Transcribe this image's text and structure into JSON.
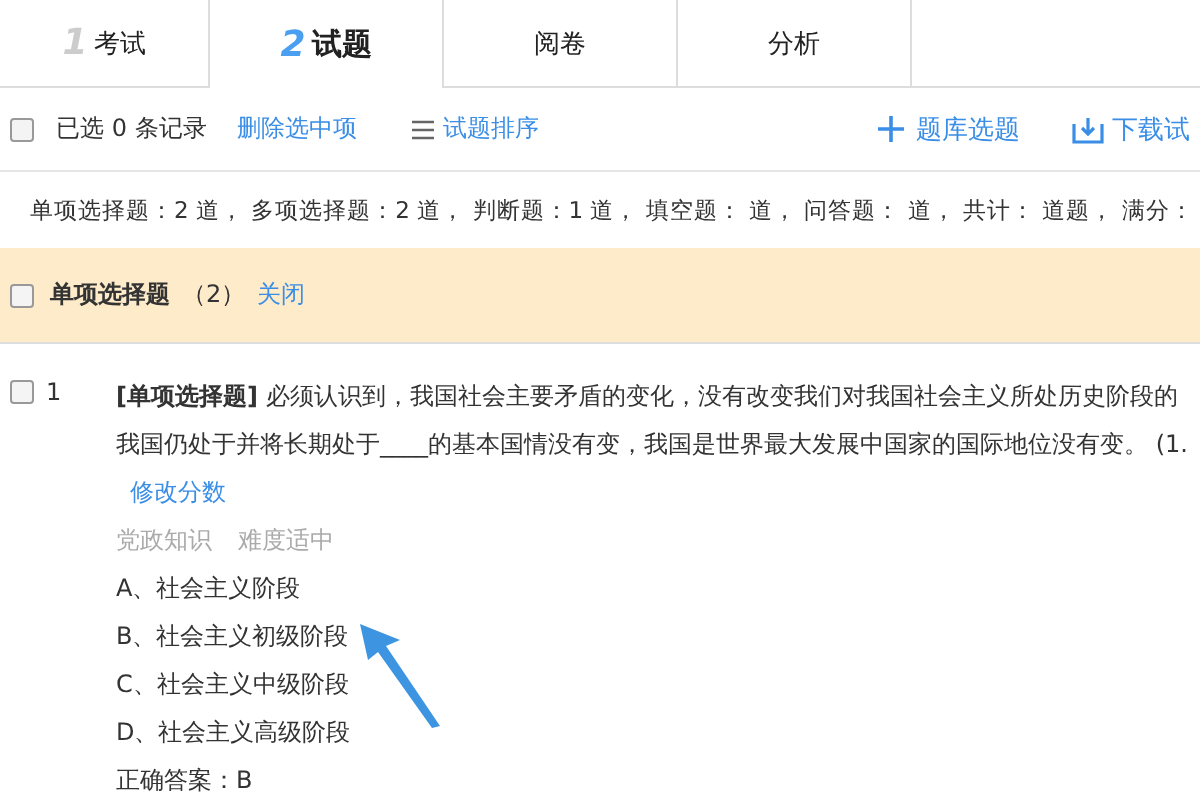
{
  "tabs": [
    {
      "number": "1",
      "label": "考试",
      "selected": false
    },
    {
      "number": "2",
      "label": "试题",
      "selected": true
    },
    {
      "label": "阅卷",
      "selected": false
    },
    {
      "label": "分析",
      "selected": false
    }
  ],
  "toolbar": {
    "select_all_checked": false,
    "selected_count": "已选 0 条记录",
    "delete_link": "删除选中项",
    "sort_link": "试题排序",
    "bank_link": "题库选题",
    "download_link": "下载试"
  },
  "summary": "单项选择题：2 道， 多项选择题：2 道， 判断题：1 道， 填空题： 道， 问答题： 道， 共计： 道题， 满分：",
  "section": {
    "checked": false,
    "title": "单项选择题",
    "count": "（2）",
    "close_link": "关闭"
  },
  "questions": [
    {
      "checked": false,
      "number": "1",
      "type": "[单项选择题]",
      "text_line_1": "必须认识到，我国社会主要矛盾的变化，没有改变我们对我国社会主义所处历史阶段的",
      "text_line_2": "我国仍处于并将长期处于____的基本国情没有变，我国是世界最大发展中国家的国际地位没有变。  (1.",
      "edit_score_link": "修改分数",
      "tags": [
        "党政知识",
        "难度适中"
      ],
      "options": [
        "A、社会主义阶段",
        "B、社会主义初级阶段",
        "C、社会主义中级阶段",
        "D、社会主义高级阶段"
      ],
      "answer": "正确答案：B"
    }
  ]
}
